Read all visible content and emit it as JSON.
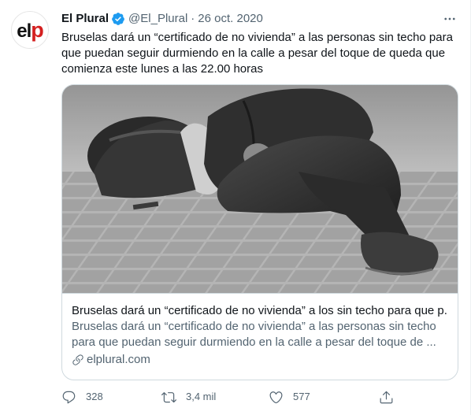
{
  "account": {
    "avatar_text_el": "el",
    "avatar_text_p": "p",
    "name": "El Plural",
    "handle": "@El_Plural",
    "separator": "·",
    "date": "26 oct. 2020"
  },
  "tweet": {
    "lines": [
      "Bruselas dará un “certificado de no vivienda” a las personas sin techo para",
      "que puedan seguir durmiendo en la calle a pesar del toque de queda que",
      "comienza este lunes a las 22.00 horas"
    ]
  },
  "card": {
    "title": "Bruselas dará un “certificado de no vivienda” a los sin techo para que p...",
    "description_lines": [
      "Bruselas dará un “certificado de no vivienda” a las personas sin techo",
      "para que puedan seguir durmiendo en la calle a pesar del toque de ..."
    ],
    "domain": "elplural.com"
  },
  "actions": {
    "replies": "328",
    "retweets": "3,4 mil",
    "likes": "577"
  },
  "icons": {
    "verified": "verified-badge-icon",
    "more": "more-options-icon",
    "link": "link-icon",
    "reply": "reply-icon",
    "retweet": "retweet-icon",
    "like": "like-icon",
    "share": "share-icon"
  },
  "colors": {
    "accent": "#1d9bf0",
    "text": "#0f1419",
    "secondary": "#536471",
    "border": "#cfd9de",
    "brand_red": "#d42020"
  }
}
